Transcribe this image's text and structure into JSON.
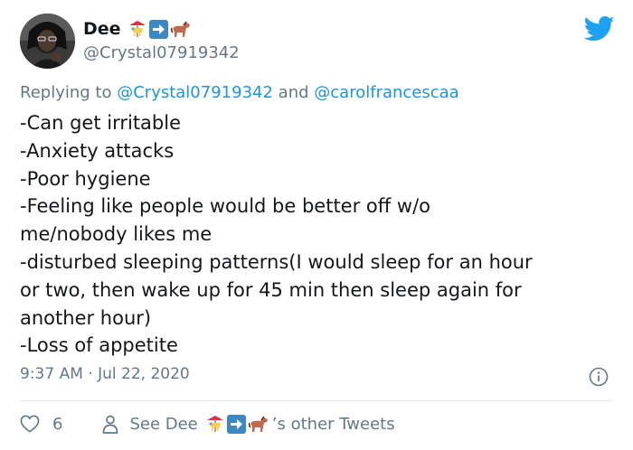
{
  "user": {
    "display_name": "Dee",
    "handle": "@Crystal07919342",
    "name_emojis": [
      "carousel-horse-icon",
      "right-arrow-icon",
      "horse-icon"
    ]
  },
  "reply": {
    "prefix": "Replying to",
    "mention_1": "@Crystal07919342",
    "conjunction": "and",
    "mention_2": "@carolfrancescaa"
  },
  "tweet": {
    "lines": [
      "-Can get irritable",
      "-Anxiety attacks",
      "-Poor hygiene",
      "-Feeling like people would be better off w/o",
      "me/nobody likes me",
      "-disturbed sleeping patterns(I would sleep for an hour",
      "or two, then wake up for 45 min then sleep again for",
      "another hour)",
      "-Loss of appetite"
    ],
    "timestamp": "9:37 AM · Jul 22, 2020"
  },
  "actions": {
    "like_count": "6",
    "see_prefix": "See Dee",
    "see_suffix": "’s other Tweets"
  },
  "colors": {
    "twitter_blue": "#1da1f2",
    "link_blue": "#1b95e0",
    "secondary_text": "#657786",
    "divider": "#e1e8ed",
    "arrow_emoji_blue": "#3b88c3"
  }
}
